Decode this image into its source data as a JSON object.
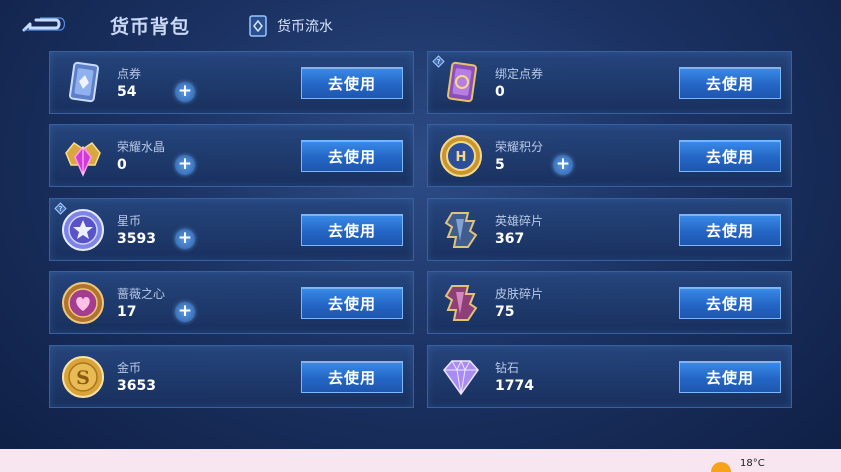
{
  "header": {
    "title": "货币背包",
    "ledger_label": "货币流水"
  },
  "currencies": [
    {
      "name": "点券",
      "amount": "54",
      "button": "去使用",
      "icon": "coupon-card-icon"
    },
    {
      "name": "绑定点券",
      "amount": "0",
      "button": "去使用",
      "icon": "bound-coupon-card-icon"
    },
    {
      "name": "荣耀水晶",
      "amount": "0",
      "button": "去使用",
      "icon": "glory-crystal-icon"
    },
    {
      "name": "荣耀积分",
      "amount": "5",
      "button": "去使用",
      "icon": "glory-points-coin-icon"
    },
    {
      "name": "星币",
      "amount": "3593",
      "button": "去使用",
      "icon": "star-coin-icon"
    },
    {
      "name": "英雄碎片",
      "amount": "367",
      "button": "去使用",
      "icon": "hero-fragment-icon"
    },
    {
      "name": "蔷薇之心",
      "amount": "17",
      "button": "去使用",
      "icon": "rose-heart-coin-icon"
    },
    {
      "name": "皮肤碎片",
      "amount": "75",
      "button": "去使用",
      "icon": "skin-fragment-icon"
    },
    {
      "name": "金币",
      "amount": "3653",
      "button": "去使用",
      "icon": "gold-coin-icon"
    },
    {
      "name": "钻石",
      "amount": "1774",
      "button": "去使用",
      "icon": "diamond-icon"
    }
  ],
  "taskbar": {
    "temperature": "18°C"
  }
}
